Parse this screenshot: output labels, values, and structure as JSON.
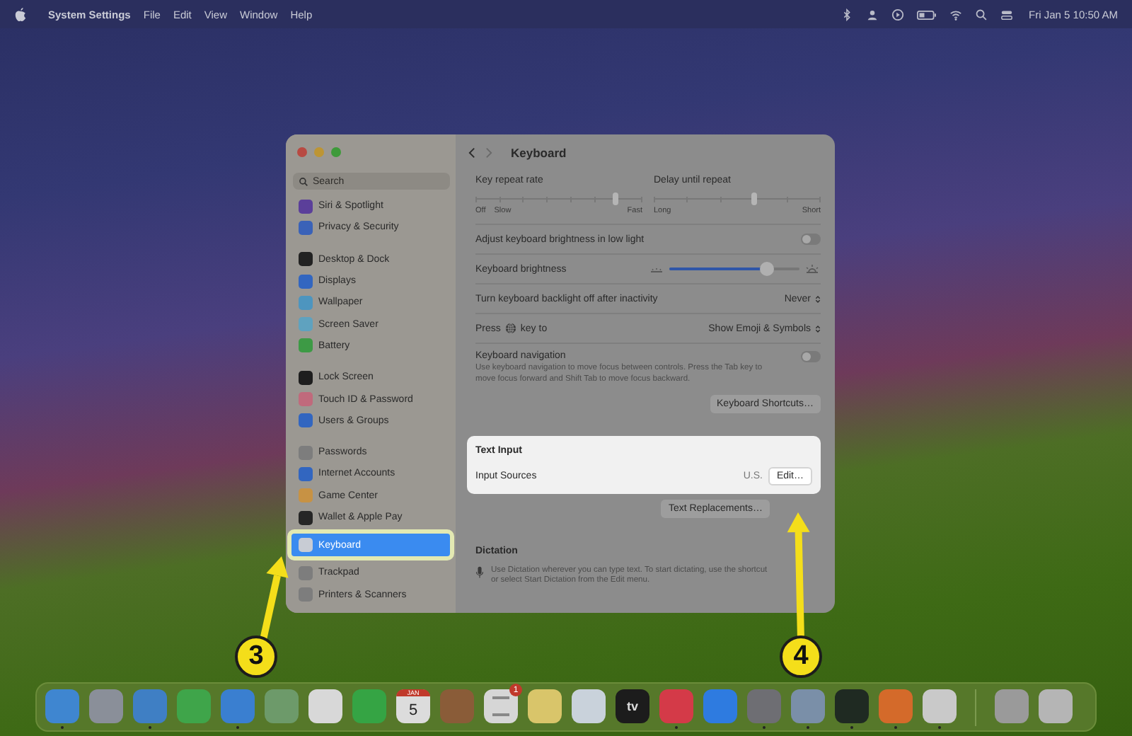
{
  "menu_bar": {
    "app_name": "System Settings",
    "menus": [
      "File",
      "Edit",
      "View",
      "Window",
      "Help"
    ],
    "clock": "Fri Jan 5  10:50 AM"
  },
  "window": {
    "search": {
      "placeholder": "Search"
    },
    "sidebar": {
      "groups": [
        {
          "items": [
            {
              "label": "Siri & Spotlight",
              "color": "#5b3f9a",
              "selected": false
            },
            {
              "label": "Privacy & Security",
              "color": "#3a62b8",
              "selected": false
            }
          ]
        },
        {
          "items": [
            {
              "label": "Desktop & Dock",
              "color": "#222222",
              "selected": false
            },
            {
              "label": "Displays",
              "color": "#3266c0",
              "selected": false
            },
            {
              "label": "Wallpaper",
              "color": "#4d95bf",
              "selected": false
            },
            {
              "label": "Screen Saver",
              "color": "#5fa2bf",
              "selected": false
            },
            {
              "label": "Battery",
              "color": "#3d9a45",
              "selected": false
            }
          ]
        },
        {
          "items": [
            {
              "label": "Lock Screen",
              "color": "#1e1e1e",
              "selected": false
            },
            {
              "label": "Touch ID & Password",
              "color": "#c06a7c",
              "selected": false
            },
            {
              "label": "Users & Groups",
              "color": "#3266c0",
              "selected": false
            }
          ]
        },
        {
          "items": [
            {
              "label": "Passwords",
              "color": "#7d7d7d",
              "selected": false
            },
            {
              "label": "Internet Accounts",
              "color": "#3266c0",
              "selected": false
            },
            {
              "label": "Game Center",
              "color": "#c79244",
              "selected": false
            },
            {
              "label": "Wallet & Apple Pay",
              "color": "#262626",
              "selected": false
            },
            {
              "label": "Keyboard",
              "color": "#c8ccd4",
              "selected": true
            },
            {
              "label": "Trackpad",
              "color": "#7d7d7d",
              "selected": false
            },
            {
              "label": "Printers & Scanners",
              "color": "#7d7d7d",
              "selected": false
            }
          ]
        }
      ]
    },
    "pane": {
      "title": "Keyboard",
      "sliders": [
        {
          "label": "Key repeat rate",
          "level": 0.84,
          "marks": [
            "Off",
            "Slow",
            "Fast"
          ]
        },
        {
          "label": "Delay until repeat",
          "level": 0.6,
          "marks": [
            "Long",
            "Short"
          ]
        }
      ],
      "rows": [
        {
          "kind": "toggle",
          "label": "Adjust keyboard brightness in low light",
          "on": false
        },
        {
          "kind": "slider",
          "label": "Keyboard brightness",
          "level": 0.75
        },
        {
          "kind": "popup",
          "label": "Turn keyboard backlight off after inactivity",
          "value": "Never"
        },
        {
          "kind": "key_popup",
          "label": "Press",
          "label_after": "key to",
          "value": "Show Emoji & Symbols"
        },
        {
          "kind": "toggle",
          "label": "Keyboard navigation",
          "description": "Use keyboard navigation to move focus between controls. Press the Tab key to move focus forward and Shift Tab to move focus backward.",
          "on": false
        }
      ],
      "shortcuts_button": "Keyboard Shortcuts…",
      "text_input": {
        "title": "Text Input",
        "row_label": "Input Sources",
        "value": "U.S.",
        "button": "Edit…"
      },
      "replacements_button": "Text Replacements…",
      "dictation": {
        "title": "Dictation",
        "description": "Use Dictation wherever you can type text. To start dictating, use the shortcut or select Start Dictation from the Edit menu."
      }
    }
  },
  "dock": {
    "items": [
      {
        "kind": "app",
        "color": "#3f86d0",
        "running": true
      },
      {
        "kind": "app",
        "color": "#8a8f99",
        "running": false
      },
      {
        "kind": "app",
        "color": "#3f7fc4",
        "running": true
      },
      {
        "kind": "app",
        "color": "#3fa54a",
        "running": false
      },
      {
        "kind": "app",
        "color": "#3a7fd0",
        "running": true
      },
      {
        "kind": "app",
        "color": "#6d9a6a",
        "running": false
      },
      {
        "kind": "app",
        "color": "#d8d8d8",
        "running": false
      },
      {
        "kind": "app",
        "color": "#35a444",
        "running": false
      },
      {
        "kind": "calendar",
        "color": "#dcdcdc",
        "month": "JAN",
        "day": "5",
        "running": false
      },
      {
        "kind": "app",
        "color": "#8a5c38",
        "running": false
      },
      {
        "kind": "badge",
        "color": "#d6d6d6",
        "badge": "1",
        "running": false
      },
      {
        "kind": "app",
        "color": "#d9c56a",
        "running": false
      },
      {
        "kind": "app",
        "color": "#c9d2db",
        "running": false
      },
      {
        "kind": "label",
        "color": "#1c1c1c",
        "label": "tv",
        "running": false
      },
      {
        "kind": "app",
        "color": "#d43a48",
        "running": true
      },
      {
        "kind": "app",
        "color": "#2e7be0",
        "running": false
      },
      {
        "kind": "app",
        "color": "#6e6e73",
        "running": true
      },
      {
        "kind": "app",
        "color": "#7a8fa8",
        "running": true
      },
      {
        "kind": "app",
        "color": "#1f2a22",
        "running": true
      },
      {
        "kind": "app",
        "color": "#d46a2a",
        "running": true
      },
      {
        "kind": "app",
        "color": "#c9c9c9",
        "running": true
      },
      {
        "kind": "separator"
      },
      {
        "kind": "app",
        "color": "#9a9a9a",
        "running": false
      },
      {
        "kind": "app",
        "color": "#b5b5b5",
        "running": false
      }
    ]
  },
  "annotations": [
    {
      "label": "3"
    },
    {
      "label": "4"
    }
  ]
}
